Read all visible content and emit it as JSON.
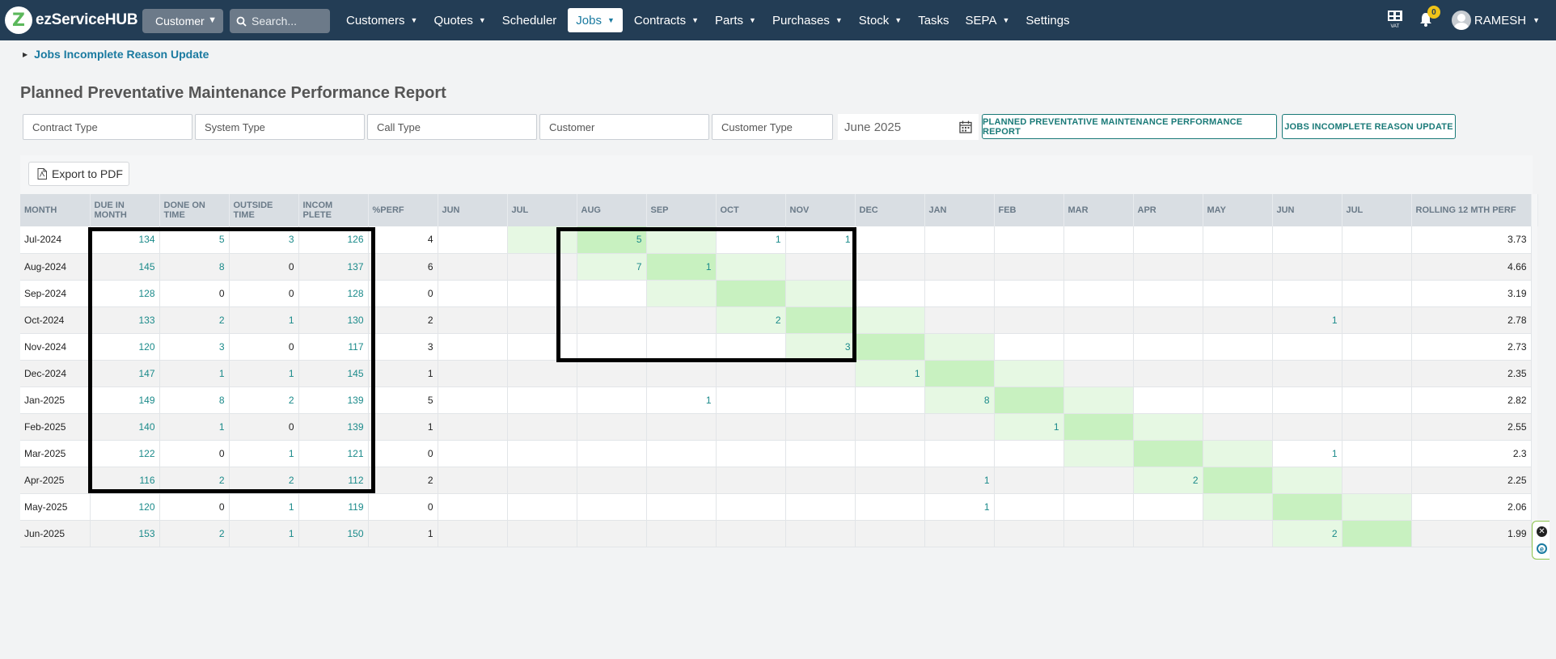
{
  "app": {
    "logo_text": "ezServiceHUB",
    "customer_select": "Customer",
    "search_placeholder": "Search...",
    "nav": [
      {
        "label": "Customers",
        "dropdown": true
      },
      {
        "label": "Quotes",
        "dropdown": true
      },
      {
        "label": "Scheduler",
        "dropdown": false
      },
      {
        "label": "Jobs",
        "dropdown": true,
        "active": true
      },
      {
        "label": "Contracts",
        "dropdown": true
      },
      {
        "label": "Parts",
        "dropdown": true
      },
      {
        "label": "Purchases",
        "dropdown": true
      },
      {
        "label": "Stock",
        "dropdown": true
      },
      {
        "label": "Tasks",
        "dropdown": false
      },
      {
        "label": "SEPA",
        "dropdown": true
      },
      {
        "label": "Settings",
        "dropdown": false
      }
    ],
    "vat_label": "VAT",
    "notification_count": "0",
    "user_name": "RAMESH"
  },
  "sub_link": "Jobs Incomplete Reason Update",
  "page_title": "Planned Preventative Maintenance Performance Report",
  "filters": {
    "contract_type": "Contract Type",
    "system_type": "System Type",
    "call_type": "Call Type",
    "customer": "Customer",
    "customer_type": "Customer Type",
    "period": "June 2025"
  },
  "buttons": {
    "ppm_report": "PLANNED PREVENTATIVE MAINTENANCE PERFORMANCE REPORT",
    "jobs_incomplete": "JOBS INCOMPLETE REASON UPDATE",
    "export_pdf": "Export to PDF"
  },
  "table": {
    "headers": [
      "MONTH",
      "DUE IN MONTH",
      "DONE ON TIME",
      "OUTSIDE TIME",
      "INCOM PLETE",
      "%PERF",
      "JUN",
      "JUL",
      "AUG",
      "SEP",
      "OCT",
      "NOV",
      "DEC",
      "JAN",
      "FEB",
      "MAR",
      "APR",
      "MAY",
      "JUN",
      "JUL",
      "ROLLING 12 MTH PERF"
    ],
    "rows": [
      {
        "month": "Jul-2024",
        "due": "134",
        "done": "5",
        "outside": "3",
        "incomplete": "126",
        "perf": "4",
        "months": [
          "",
          "",
          "5",
          "",
          "1",
          "1",
          "",
          "",
          "",
          "",
          "",
          "",
          "",
          ""
        ],
        "rolling": "3.73"
      },
      {
        "month": "Aug-2024",
        "due": "145",
        "done": "8",
        "outside": "0",
        "incomplete": "137",
        "perf": "6",
        "months": [
          "",
          "",
          "7",
          "1",
          "",
          "",
          "",
          "",
          "",
          "",
          "",
          "",
          "",
          ""
        ],
        "rolling": "4.66"
      },
      {
        "month": "Sep-2024",
        "due": "128",
        "done": "0",
        "outside": "0",
        "incomplete": "128",
        "perf": "0",
        "months": [
          "",
          "",
          "",
          "",
          "",
          "",
          "",
          "",
          "",
          "",
          "",
          "",
          "",
          ""
        ],
        "rolling": "3.19"
      },
      {
        "month": "Oct-2024",
        "due": "133",
        "done": "2",
        "outside": "1",
        "incomplete": "130",
        "perf": "2",
        "months": [
          "",
          "",
          "",
          "",
          "2",
          "",
          "",
          "",
          "",
          "",
          "",
          "",
          "1",
          ""
        ],
        "rolling": "2.78"
      },
      {
        "month": "Nov-2024",
        "due": "120",
        "done": "3",
        "outside": "0",
        "incomplete": "117",
        "perf": "3",
        "months": [
          "",
          "",
          "",
          "",
          "",
          "3",
          "",
          "",
          "",
          "",
          "",
          "",
          "",
          ""
        ],
        "rolling": "2.73"
      },
      {
        "month": "Dec-2024",
        "due": "147",
        "done": "1",
        "outside": "1",
        "incomplete": "145",
        "perf": "1",
        "months": [
          "",
          "",
          "",
          "",
          "",
          "",
          "1",
          "",
          "",
          "",
          "",
          "",
          "",
          ""
        ],
        "rolling": "2.35"
      },
      {
        "month": "Jan-2025",
        "due": "149",
        "done": "8",
        "outside": "2",
        "incomplete": "139",
        "perf": "5",
        "months": [
          "",
          "",
          "",
          "1",
          "",
          "",
          "",
          "8",
          "",
          "",
          "",
          "",
          "",
          ""
        ],
        "rolling": "2.82"
      },
      {
        "month": "Feb-2025",
        "due": "140",
        "done": "1",
        "outside": "0",
        "incomplete": "139",
        "perf": "1",
        "months": [
          "",
          "",
          "",
          "",
          "",
          "",
          "",
          "",
          "1",
          "",
          "",
          "",
          "",
          ""
        ],
        "rolling": "2.55"
      },
      {
        "month": "Mar-2025",
        "due": "122",
        "done": "0",
        "outside": "1",
        "incomplete": "121",
        "perf": "0",
        "months": [
          "",
          "",
          "",
          "",
          "",
          "",
          "",
          "",
          "",
          "",
          "",
          "",
          "1",
          ""
        ],
        "rolling": "2.3"
      },
      {
        "month": "Apr-2025",
        "due": "116",
        "done": "2",
        "outside": "2",
        "incomplete": "112",
        "perf": "2",
        "months": [
          "",
          "",
          "",
          "",
          "",
          "",
          "",
          "1",
          "",
          "",
          "2",
          "",
          "",
          ""
        ],
        "rolling": "2.25"
      },
      {
        "month": "May-2025",
        "due": "120",
        "done": "0",
        "outside": "1",
        "incomplete": "119",
        "perf": "0",
        "months": [
          "",
          "",
          "",
          "",
          "",
          "",
          "",
          "1",
          "",
          "",
          "",
          "",
          "",
          ""
        ],
        "rolling": "2.06"
      },
      {
        "month": "Jun-2025",
        "due": "153",
        "done": "2",
        "outside": "1",
        "incomplete": "150",
        "perf": "1",
        "months": [
          "",
          "",
          "",
          "",
          "",
          "",
          "",
          "",
          "",
          "",
          "",
          "",
          "2",
          ""
        ],
        "rolling": "1.99"
      }
    ],
    "highlight": {
      "light": "#e6f8e3",
      "strong": "#c8f1c0"
    }
  },
  "colors": {
    "navbar": "#233d55",
    "link": "#1a7aa0",
    "accent_outline": "#1a7a78",
    "value_teal": "#1a8a8a"
  }
}
